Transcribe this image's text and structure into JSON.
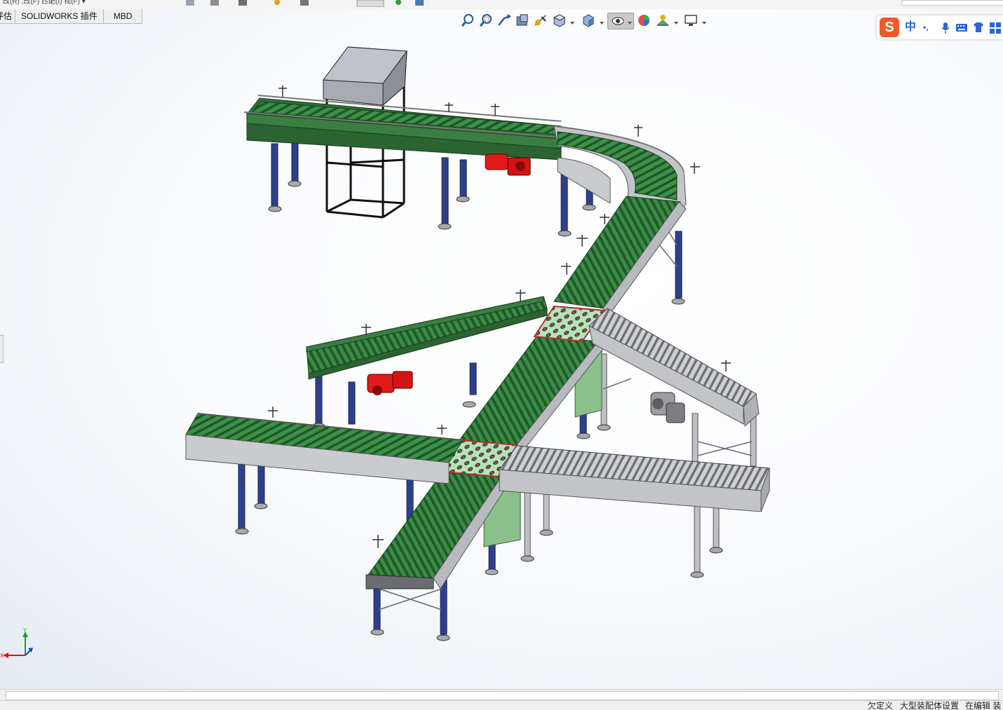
{
  "top_strip": {
    "fragment_text": "改(R)  ,改(F)  匹配(I)  视(F)  ▾"
  },
  "tabs": [
    {
      "label": "评估"
    },
    {
      "label": "SOLIDWORKS 插件"
    },
    {
      "label": "MBD"
    }
  ],
  "view_toolbar": {
    "items": [
      {
        "icon": "zoom-to-fit-icon"
      },
      {
        "icon": "zoom-to-area-icon"
      },
      {
        "icon": "previous-view-icon"
      },
      {
        "icon": "section-view-icon"
      },
      {
        "icon": "dynamic-annotation-icon"
      },
      {
        "icon": "view-orientation-icon"
      },
      {
        "icon": "display-style-icon"
      },
      {
        "icon": "hide-show-items-icon"
      },
      {
        "icon": "edit-appearance-icon"
      },
      {
        "icon": "apply-scene-icon"
      },
      {
        "icon": "view-settings-icon"
      }
    ]
  },
  "ime_bar": {
    "logo": "S",
    "mode": "中",
    "punct": "•,",
    "icons": [
      "microphone-icon",
      "keyboard-icon",
      "skin-icon",
      "toolbox-icon"
    ]
  },
  "triad": {
    "x_label": "X",
    "y_label": "Y"
  },
  "status_bar": {
    "left": "欠定义",
    "middle": "大型装配体设置",
    "right": "在编辑 装"
  },
  "colors": {
    "roller_green": "#2f7a3a",
    "frame_gray": "#c8c8cc",
    "leg_blue": "#2c3f88",
    "motor_red": "#e01818",
    "transfer_red": "#d85050"
  }
}
